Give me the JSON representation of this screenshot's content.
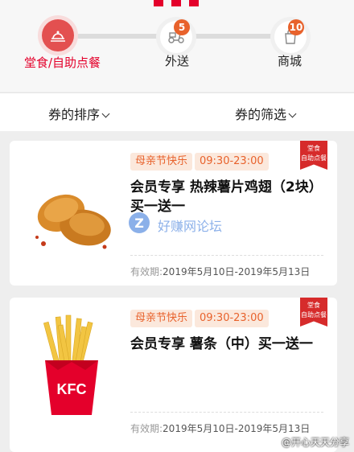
{
  "steps": [
    {
      "label": "堂食/自助点餐",
      "icon": "tray-icon",
      "active": true
    },
    {
      "label": "外送",
      "icon": "scooter-icon",
      "badge": "5",
      "active": false
    },
    {
      "label": "商城",
      "icon": "bag-icon",
      "badge": "10",
      "active": false
    }
  ],
  "filters": {
    "sort_label": "券的排序",
    "filter_label": "券的筛选"
  },
  "coupons": [
    {
      "tag_event": "母亲节快乐",
      "tag_time": "09:30-23:00",
      "ribbon": [
        "堂食",
        "自助点餐"
      ],
      "title": "会员专享 热辣薯片鸡翅（2块）买一送一",
      "validity_label": "有效期:",
      "validity_value": "2019年5月10日-2019年5月13日",
      "image": "chicken-wings-image"
    },
    {
      "tag_event": "母亲节快乐",
      "tag_time": "09:30-23:00",
      "ribbon": [
        "堂食",
        "自助点餐"
      ],
      "title": "会员专享 薯条（中）买一送一",
      "validity_label": "有效期:",
      "validity_value": "2019年5月10日-2019年5月13日",
      "image": "french-fries-image"
    }
  ],
  "watermark": {
    "text": "好赚网论坛",
    "letter": "Z"
  },
  "weibo": "@开心天天分享",
  "colors": {
    "brand_red": "#e4002b",
    "accent_orange": "#e8622c",
    "tag_bg": "#fbe8dc"
  }
}
